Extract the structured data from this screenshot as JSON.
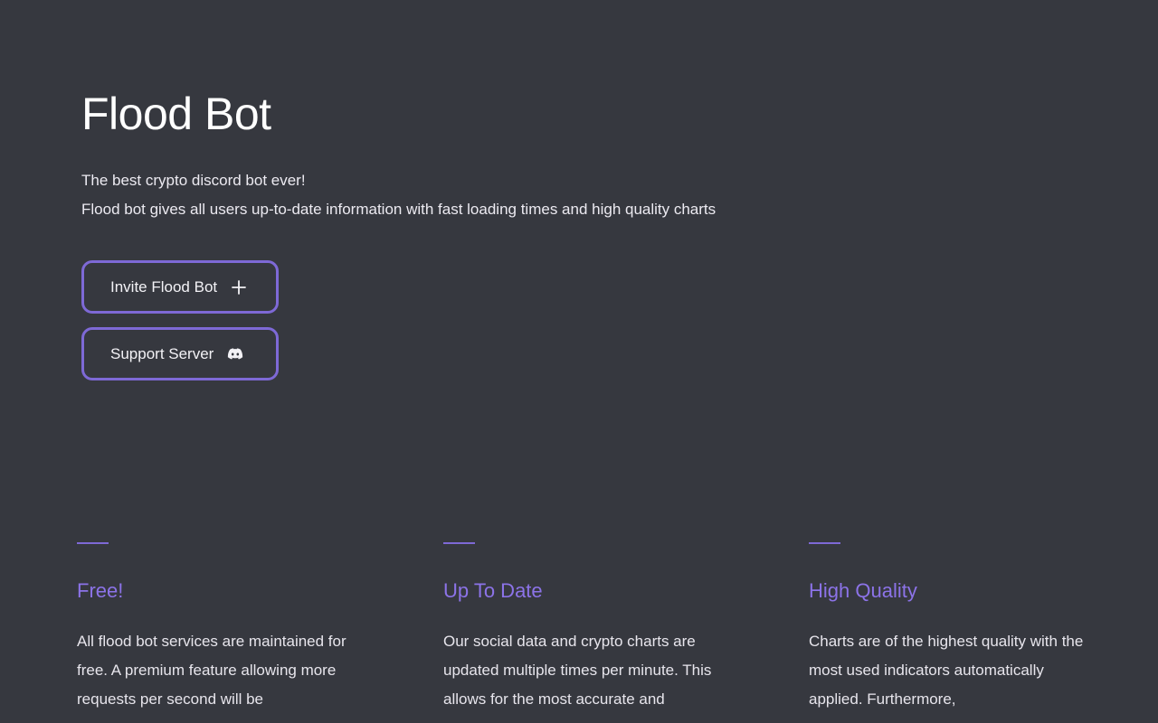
{
  "hero": {
    "title": "Flood Bot",
    "tagline_1": "The best crypto discord bot ever!",
    "tagline_2": "Flood bot gives all users up-to-date information with fast loading times and high quality charts"
  },
  "buttons": {
    "invite_label": "Invite Flood Bot",
    "invite_icon": "plus-icon",
    "support_label": "Support Server",
    "support_icon": "discord-icon"
  },
  "features": [
    {
      "title": "Free!",
      "text": "All flood bot services are maintained for free. A premium feature allowing more requests per second will be"
    },
    {
      "title": "Up To Date",
      "text": "Our social data and crypto charts are updated multiple times per minute. This allows for the most accurate and"
    },
    {
      "title": "High Quality",
      "text": "Charts are of the highest quality with the most used indicators automatically applied. Furthermore,"
    }
  ],
  "colors": {
    "background": "#36383f",
    "accent": "#7e69d6",
    "feature_title": "#8c73e8"
  }
}
